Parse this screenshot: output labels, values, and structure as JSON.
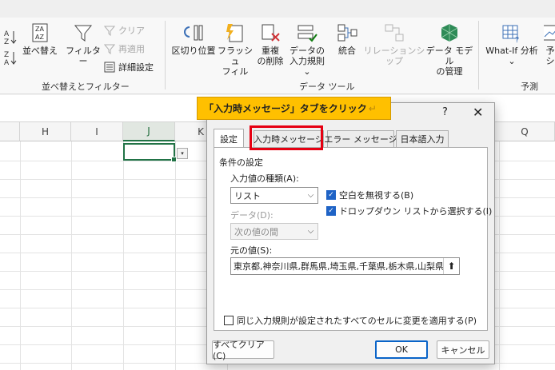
{
  "ribbon": {
    "sort_group": {
      "sort_az": "A↓Z",
      "sort_za": "Z↓A",
      "sort_label": "並べ替え",
      "filter_label": "フィルター",
      "clear_label": "クリア",
      "reapply_label": "再適用",
      "advanced_label": "詳細設定",
      "group_label": "並べ替えとフィルター"
    },
    "data_tools": {
      "split_label": "区切り位置",
      "flash_label_1": "フラッシュ",
      "flash_label_2": "フィル",
      "dup_label_1": "重複",
      "dup_label_2": "の削除",
      "validation_label_1": "データの",
      "validation_label_2": "入力規則 ⌄",
      "consolidate_label": "統合",
      "relationship_label": "リレーションシップ",
      "model_label_1": "データ モデル",
      "model_label_2": "の管理",
      "group_label": "データ ツール"
    },
    "forecast": {
      "whatif_label": "What-If 分析",
      "whatif_arrow": "⌄",
      "forecast_partial": "予",
      "forecast_partial2": "シ",
      "group_label": "予測"
    }
  },
  "sheet": {
    "columns": [
      "H",
      "I",
      "J",
      "K",
      "",
      "",
      "",
      "",
      "",
      "Q"
    ],
    "dropdown_arrow": "▾"
  },
  "callout": {
    "text": "「入力時メッセージ」タブをクリック",
    "return_mark": "↵"
  },
  "dialog": {
    "help": "?",
    "close": "✕",
    "tabs": [
      "設定",
      "入力時メッセージ",
      "エラー メッセージ",
      "日本語入力"
    ],
    "section_label": "条件の設定",
    "allow_label": "入力値の種類(A):",
    "allow_value": "リスト",
    "data_label": "データ(D):",
    "data_value": "次の値の間",
    "ignore_blank_label": "空白を無視する(B)",
    "in_cell_dropdown_label": "ドロップダウン リストから選択する(I)",
    "source_label": "元の値(S):",
    "source_value": "東京都,神奈川県,群馬県,埼玉県,千葉県,栃木県,山梨県",
    "source_btn": "⬆",
    "apply_all_label": "同じ入力規則が設定されたすべてのセルに変更を適用する(P)",
    "clear_all_label": "すべてクリア(C)",
    "ok_label": "OK",
    "cancel_label": "キャンセル",
    "combo_arrow": "⌵",
    "check_mark": "✓"
  },
  "colors": {
    "excel_green": "#217346",
    "callout_yellow": "#ffc000",
    "highlight_red": "#e60012",
    "ok_blue": "#0a64c8"
  }
}
